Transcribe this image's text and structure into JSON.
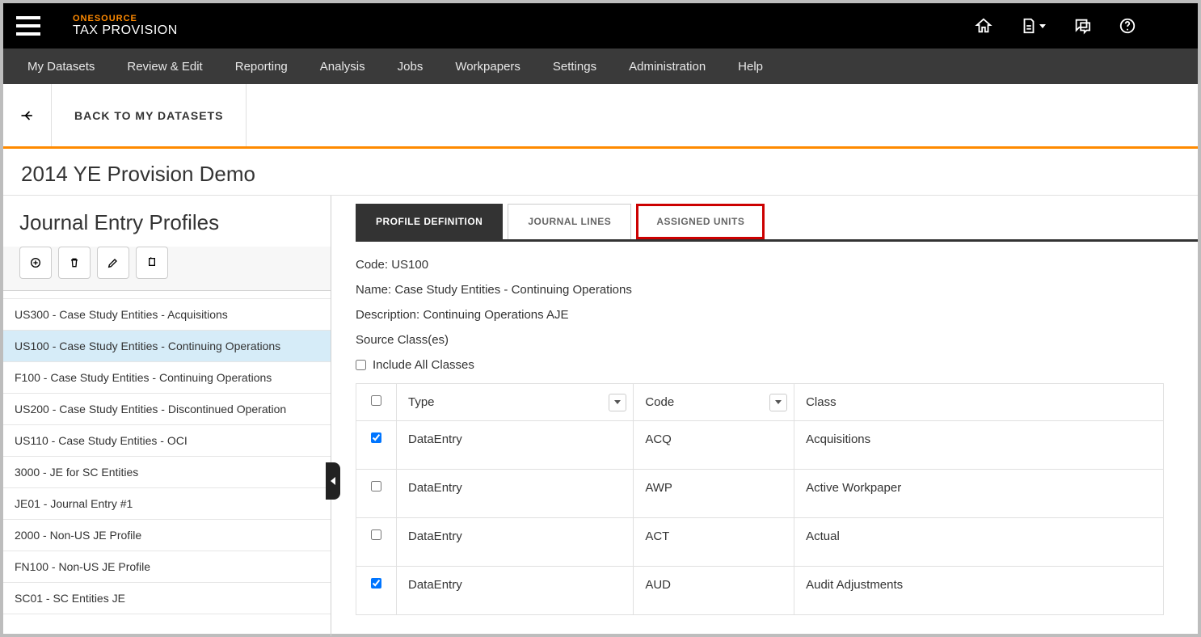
{
  "brand": {
    "top": "ONESOURCE",
    "bottom": "TAX PROVISION"
  },
  "nav": {
    "items": [
      "My Datasets",
      "Review & Edit",
      "Reporting",
      "Analysis",
      "Jobs",
      "Workpapers",
      "Settings",
      "Administration",
      "Help"
    ]
  },
  "backbar": {
    "label": "BACK TO MY DATASETS"
  },
  "dataset_title": "2014 YE Provision Demo",
  "left": {
    "title": "Journal Entry Profiles",
    "profiles": [
      "US300 - Case Study Entities - Acquisitions",
      "US100 - Case Study Entities - Continuing Operations",
      "F100 - Case Study Entities - Continuing Operations",
      "US200 - Case Study Entities - Discontinued Operation",
      "US110 - Case Study Entities - OCI",
      "3000 - JE for SC Entities",
      "JE01 - Journal Entry #1",
      "2000 - Non-US JE Profile",
      "FN100 - Non-US JE Profile",
      "SC01 - SC Entities JE"
    ],
    "selected_index": 1
  },
  "tabs": {
    "items": [
      "PROFILE DEFINITION",
      "JOURNAL LINES",
      "ASSIGNED UNITS"
    ],
    "active_index": 0,
    "highlight_index": 2
  },
  "details": {
    "code_label": "Code:",
    "code": "US100",
    "name_label": "Name:",
    "name": "Case Study Entities - Continuing Operations",
    "desc_label": "Description:",
    "desc": "Continuing Operations AJE",
    "source_classes_label": "Source Class(es)",
    "include_all_label": "Include All Classes",
    "include_all_checked": false
  },
  "table": {
    "headers": {
      "type": "Type",
      "code": "Code",
      "class": "Class"
    },
    "rows": [
      {
        "checked": true,
        "type": "DataEntry",
        "code": "ACQ",
        "class": "Acquisitions"
      },
      {
        "checked": false,
        "type": "DataEntry",
        "code": "AWP",
        "class": "Active Workpaper"
      },
      {
        "checked": false,
        "type": "DataEntry",
        "code": "ACT",
        "class": "Actual"
      },
      {
        "checked": true,
        "type": "DataEntry",
        "code": "AUD",
        "class": "Audit Adjustments"
      }
    ]
  }
}
